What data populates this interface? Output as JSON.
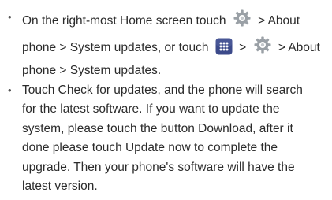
{
  "instructions": [
    {
      "segments": [
        {
          "text": "On the right-most Home screen touch"
        },
        {
          "icon": "gear-icon"
        },
        {
          "text": "> About"
        }
      ],
      "line2": [
        {
          "text": "phone > System updates, or touch"
        },
        {
          "icon": "apps-icon"
        },
        {
          "text": ">"
        },
        {
          "icon": "gear-icon"
        },
        {
          "text": "> About"
        }
      ],
      "line3": "phone > System updates."
    },
    {
      "lines": [
        "Touch Check for updates, and the phone will search",
        "for the latest software. If you want to update the",
        "system, please touch the button Download, after it",
        "done please touch Update now to complete the",
        "upgrade. Then your phone's software will have the",
        "latest version."
      ]
    }
  ],
  "bullet_glyph": "•",
  "colors": {
    "text": "#2b2b2b",
    "gear_icon": "#9aa0a6",
    "apps_icon_bg": "#3c4a8a",
    "apps_icon_dots": "#ffffff"
  }
}
